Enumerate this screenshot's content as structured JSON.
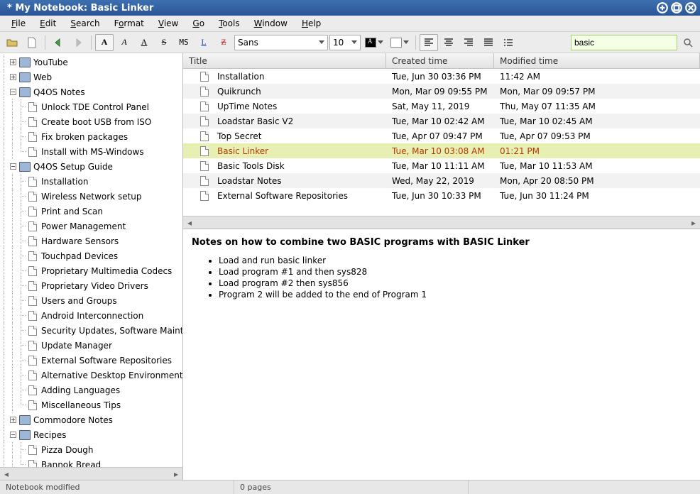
{
  "window": {
    "title": "* My Notebook: Basic Linker"
  },
  "menu": {
    "file": "File",
    "edit": "Edit",
    "search": "Search",
    "format": "Format",
    "view": "View",
    "go": "Go",
    "tools": "Tools",
    "window": "Window",
    "help": "Help"
  },
  "toolbar": {
    "font_family": "Sans",
    "font_size": "10",
    "ms_label": "MS",
    "search_value": "basic"
  },
  "tree": {
    "youtube": "YouTube",
    "web": "Web",
    "q4os_notes": "Q4OS Notes",
    "q4os_notes_children": [
      "Unlock TDE Control Panel",
      "Create boot USB from ISO",
      "Fix broken packages",
      "Install with MS-Windows"
    ],
    "q4os_setup": "Q4OS Setup Guide",
    "q4os_setup_children": [
      "Installation",
      "Wireless Network setup",
      "Print and Scan",
      "Power Management",
      "Hardware Sensors",
      "Touchpad Devices",
      "Proprietary Multimedia Codecs",
      "Proprietary Video Drivers",
      "Users and Groups",
      "Android Interconnection",
      "Security Updates, Software Maintenance",
      "Update Manager",
      "External Software Repositories",
      "Alternative Desktop Environments",
      "Adding Languages",
      "Miscellaneous Tips"
    ],
    "commodore": "Commodore Notes",
    "recipes": "Recipes",
    "recipes_children": [
      "Pizza Dough",
      "Bannok Bread"
    ]
  },
  "list": {
    "headers": {
      "title": "Title",
      "created": "Created time",
      "modified": "Modified time"
    },
    "rows": [
      {
        "title": "Installation",
        "created": "Tue, Jun 30 03:36 PM",
        "modified": "11:42 AM",
        "selected": false
      },
      {
        "title": "Quikrunch",
        "created": "Mon, Mar 09 09:55 PM",
        "modified": "Mon, Mar 09 09:57 PM",
        "selected": false
      },
      {
        "title": "UpTime Notes",
        "created": "Sat, May 11, 2019",
        "modified": "Thu, May 07 11:35 AM",
        "selected": false
      },
      {
        "title": "Loadstar Basic V2",
        "created": "Tue, Mar 10 02:42 AM",
        "modified": "Tue, Mar 10 02:45 AM",
        "selected": false
      },
      {
        "title": "Top Secret",
        "created": "Tue, Apr 07 09:47 PM",
        "modified": "Tue, Apr 07 09:53 PM",
        "selected": false
      },
      {
        "title": "Basic Linker",
        "created": "Tue, Mar 10 03:08 AM",
        "modified": "01:21 PM",
        "selected": true
      },
      {
        "title": "Basic Tools Disk",
        "created": "Tue, Mar 10 11:11 AM",
        "modified": "Tue, Mar 10 11:53 AM",
        "selected": false
      },
      {
        "title": "Loadstar Notes",
        "created": "Wed, May 22, 2019",
        "modified": "Mon, Apr 20 08:50 PM",
        "selected": false
      },
      {
        "title": "External Software Repositories",
        "created": "Tue, Jun 30 10:33 PM",
        "modified": "Tue, Jun 30 11:24 PM",
        "selected": false
      }
    ]
  },
  "editor": {
    "heading": "Notes on how to combine two BASIC programs with BASIC Linker",
    "bullets": [
      "Load and run basic linker",
      "Load program #1 and then sys828",
      "Load program #2 then sys856",
      "Program 2 will be added to the end of Program 1"
    ]
  },
  "status": {
    "left": "Notebook modified",
    "mid": "0 pages",
    "right": ""
  }
}
